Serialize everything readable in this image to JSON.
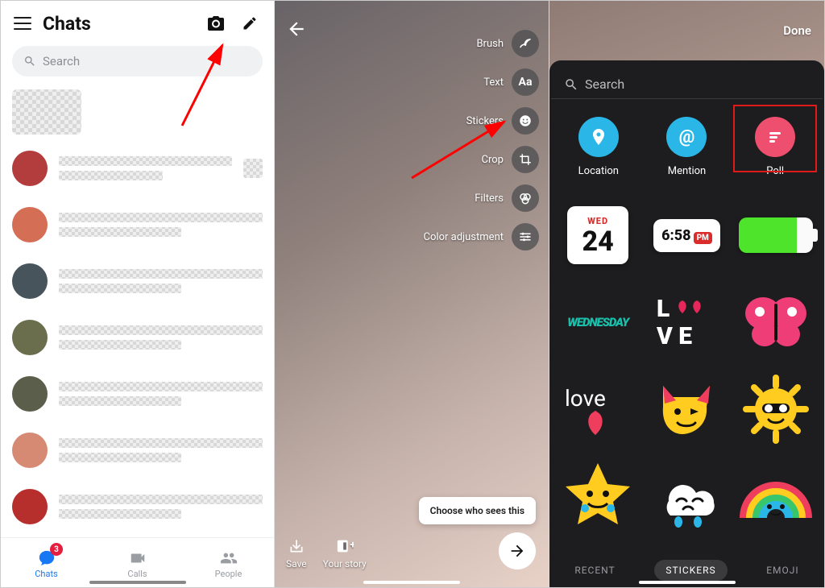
{
  "panel1": {
    "title": "Chats",
    "search_placeholder": "Search",
    "tabs": [
      {
        "label": "Chats",
        "badge": "3"
      },
      {
        "label": "Calls"
      },
      {
        "label": "People"
      }
    ]
  },
  "panel2": {
    "tools": [
      {
        "label": "Brush"
      },
      {
        "label": "Text"
      },
      {
        "label": "Stickers"
      },
      {
        "label": "Crop"
      },
      {
        "label": "Filters"
      },
      {
        "label": "Color adjustment"
      }
    ],
    "choose": "Choose who sees this",
    "actions": {
      "save": "Save",
      "story": "Your story"
    }
  },
  "panel3": {
    "done": "Done",
    "search_placeholder": "Search",
    "quick": [
      {
        "label": "Location"
      },
      {
        "label": "Mention"
      },
      {
        "label": "Poll"
      }
    ],
    "date": {
      "dow": "WED",
      "num": "24"
    },
    "time": {
      "t": "6:58",
      "ampm": "PM"
    },
    "wednesday": "WEDNESDAY",
    "tabs": [
      {
        "label": "RECENT"
      },
      {
        "label": "STICKERS"
      },
      {
        "label": "EMOJI"
      }
    ]
  }
}
